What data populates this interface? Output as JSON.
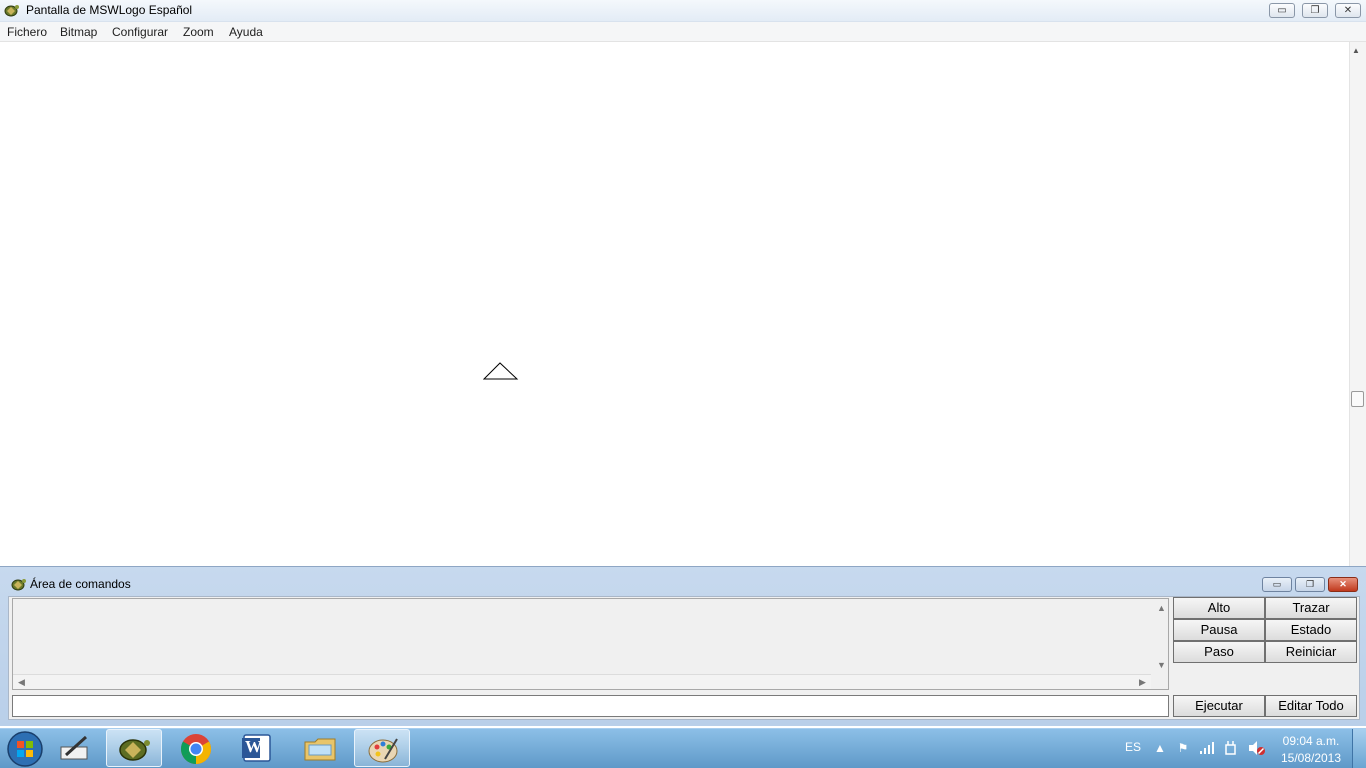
{
  "window": {
    "title": "Pantalla de MSWLogo Español",
    "controls": {
      "minimize": "▭",
      "restore": "❐",
      "close": "✕"
    }
  },
  "menubar": {
    "items": [
      {
        "label": "Fichero"
      },
      {
        "label": "Bitmap"
      },
      {
        "label": "Configurar"
      },
      {
        "label": "Zoom"
      },
      {
        "label": "Ayuda"
      }
    ]
  },
  "canvas": {
    "turtle_icon": "turtle-triangle-icon"
  },
  "command_area": {
    "title": "Área de comandos",
    "history_text": "",
    "input_value": "",
    "buttons": {
      "alto": "Alto",
      "trazar": "Trazar",
      "pausa": "Pausa",
      "estado": "Estado",
      "paso": "Paso",
      "reiniciar": "Reiniciar",
      "ejecutar": "Ejecutar",
      "editar_todo": "Editar Todo"
    }
  },
  "taskbar": {
    "apps": [
      {
        "name": "start-orb-icon"
      },
      {
        "name": "pen-tablet-icon"
      },
      {
        "name": "mswlogo-turtle-icon",
        "active": true
      },
      {
        "name": "chrome-icon"
      },
      {
        "name": "word-icon",
        "letter": "W"
      },
      {
        "name": "file-explorer-icon"
      },
      {
        "name": "paint-icon",
        "active": true
      }
    ],
    "language": "ES",
    "time": "09:04 a.m.",
    "date": "15/08/2013"
  },
  "colors": {
    "title_gradient_top": "#f4f8fc",
    "command_frame": "#c7d9ee",
    "taskbar": "#6ea8d6",
    "close_red": "#c0391d"
  }
}
